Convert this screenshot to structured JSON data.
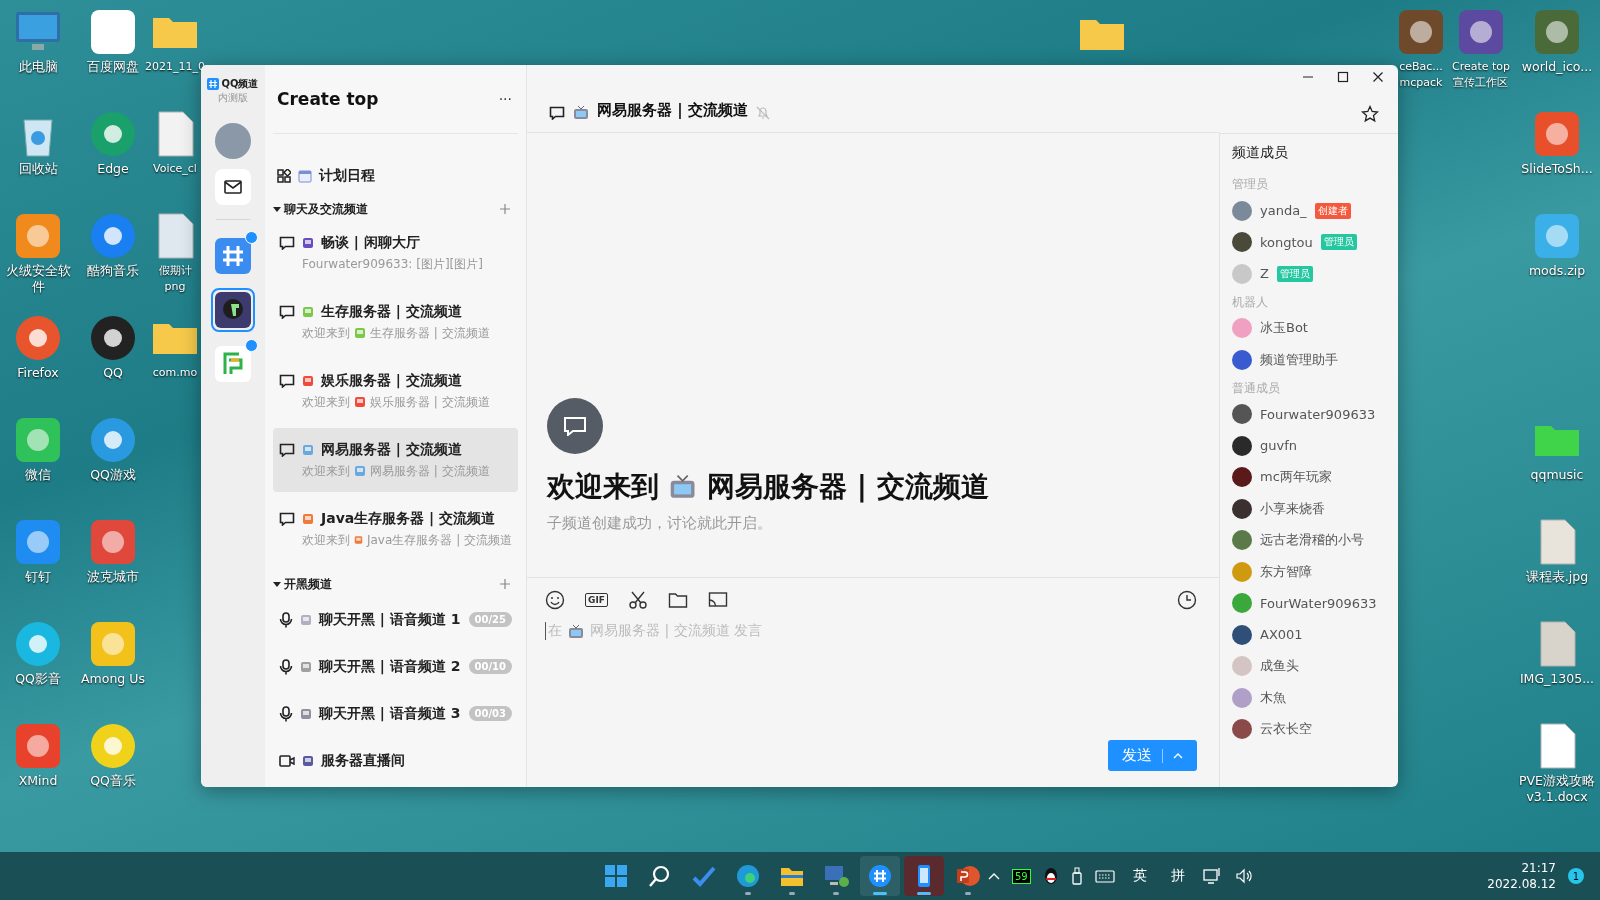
{
  "desktop": {
    "icons": [
      {
        "label": "此电脑"
      },
      {
        "label": "回收站"
      },
      {
        "label": "火绒安全软件"
      },
      {
        "label": "Firefox"
      },
      {
        "label": "微信"
      },
      {
        "label": "钉钉"
      },
      {
        "label": "QQ影音"
      },
      {
        "label": "XMind"
      },
      {
        "label": "百度网盘"
      },
      {
        "label": "Edge"
      },
      {
        "label": "酷狗音乐"
      },
      {
        "label": "QQ"
      },
      {
        "label": "QQ游戏"
      },
      {
        "label": "波克城市"
      },
      {
        "label": "Among Us"
      },
      {
        "label": "QQ音乐"
      },
      {
        "label": "2021_11_0"
      },
      {
        "label": "Voice_cl"
      },
      {
        "label": "假期计\npng"
      },
      {
        "label": "com.mo"
      },
      {
        "label": "ceBac...\nmcpack"
      },
      {
        "label": "Create top\n宣传工作区"
      },
      {
        "label": "world_ico..."
      },
      {
        "label": "SlideToSh..."
      },
      {
        "label": "mods.zip"
      },
      {
        "label": "qqmusic"
      },
      {
        "label": "课程表.jpg"
      },
      {
        "label": "IMG_1305..."
      },
      {
        "label": "PVE游戏攻略\nv3.1.docx"
      }
    ]
  },
  "window": {
    "rail": {
      "logo": "QQ频道",
      "logo_sub": "内测版",
      "servers": [
        {
          "selected": false,
          "unread": true
        },
        {
          "selected": true,
          "unread": false
        },
        {
          "selected": false,
          "unread": true
        }
      ]
    },
    "channel_list": {
      "title": "Create top",
      "more": "···",
      "schedule": "计划日程",
      "categories": [
        {
          "name": "聊天及交流频道",
          "expanded": true,
          "channels": [
            {
              "kind": "text",
              "name": "畅谈 | 闲聊大厅",
              "preview": "Fourwater909633: [图片][图片]",
              "selected": false
            },
            {
              "kind": "text",
              "name": "生存服务器 | 交流频道",
              "preview_prefix": "欢迎来到",
              "preview": "生存服务器 | 交流频道",
              "selected": false
            },
            {
              "kind": "text",
              "name": "娱乐服务器 | 交流频道",
              "preview_prefix": "欢迎来到",
              "preview": "娱乐服务器 | 交流频道",
              "selected": false
            },
            {
              "kind": "text",
              "name": "网易服务器 | 交流频道",
              "preview_prefix": "欢迎来到",
              "preview": "网易服务器 | 交流频道",
              "selected": true
            },
            {
              "kind": "text",
              "name": "Java生存服务器 | 交流频道",
              "preview_prefix": "欢迎来到",
              "preview": "Java生存服务器 | 交流频道",
              "selected": false
            }
          ]
        },
        {
          "name": "开黑频道",
          "expanded": true,
          "channels": [
            {
              "kind": "voice",
              "name": "聊天开黑 | 语音频道 1",
              "count": "00/25",
              "selected": false
            },
            {
              "kind": "voice",
              "name": "聊天开黑 | 语音频道 2",
              "count": "00/10",
              "selected": false
            },
            {
              "kind": "voice",
              "name": "聊天开黑 | 语音频道 3",
              "count": "00/03",
              "selected": false
            },
            {
              "kind": "live",
              "name": "服务器直播间",
              "selected": false
            }
          ]
        }
      ]
    },
    "chat": {
      "title": "网易服务器 | 交流频道",
      "muted": true,
      "welcome_prefix": "欢迎来到",
      "welcome_title": "网易服务器 | 交流频道",
      "welcome_sub": "子频道创建成功，讨论就此开启。",
      "composer": {
        "gif": "GIF",
        "placeholder_before": "在",
        "placeholder_after": "网易服务器 | 交流频道 发言",
        "send": "发送"
      }
    },
    "members": {
      "title": "频道成员",
      "groups": [
        {
          "name": "管理员",
          "members": [
            {
              "name": "yanda_",
              "badge": "创建者",
              "color": "#f5593d"
            },
            {
              "name": "kongtou",
              "badge": "管理员",
              "color": "#25c7a0"
            },
            {
              "name": "Z",
              "badge": "管理员",
              "color": "#25c7a0"
            }
          ]
        },
        {
          "name": "机器人",
          "members": [
            {
              "name": "冰玉Bot"
            },
            {
              "name": "频道管理助手"
            }
          ]
        },
        {
          "name": "普通成员",
          "members": [
            {
              "name": "Fourwater909633"
            },
            {
              "name": "guvfn"
            },
            {
              "name": "mc两年玩家"
            },
            {
              "name": "小享来烧香"
            },
            {
              "name": "远古老滑稽的小号"
            },
            {
              "name": "东方智障"
            },
            {
              "name": "FourWater909633"
            },
            {
              "name": "AX001"
            },
            {
              "name": "成鱼头"
            },
            {
              "name": "木魚"
            },
            {
              "name": "云衣长空"
            }
          ]
        }
      ]
    }
  },
  "taskbar": {
    "apps": [
      {
        "running": false,
        "selected": false
      },
      {
        "running": false,
        "selected": false
      },
      {
        "running": false,
        "selected": false
      },
      {
        "running": true,
        "selected": false
      },
      {
        "running": true,
        "selected": false
      },
      {
        "running": true,
        "selected": false
      },
      {
        "running": true,
        "selected": true
      },
      {
        "running": true,
        "selected": true
      },
      {
        "running": true,
        "selected": false
      }
    ],
    "tray": {
      "counter": "59",
      "lang": "英",
      "ime": "拼",
      "time": "21:17",
      "date": "2022.08.12",
      "notifications": "1"
    }
  }
}
